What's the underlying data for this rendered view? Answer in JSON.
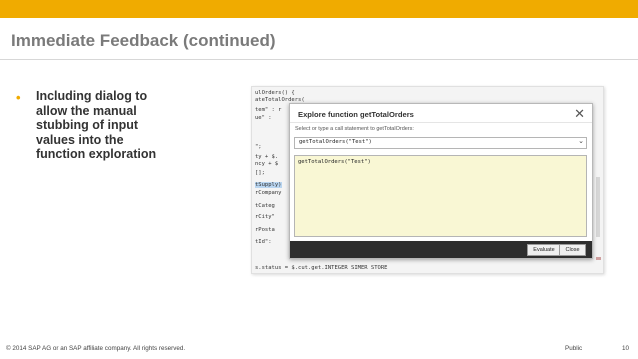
{
  "slide": {
    "title": "Immediate Feedback (continued)",
    "bullet": {
      "marker": "•",
      "lines": [
        "Including dialog to",
        "allow the manual",
        "stubbing of input",
        "values into the",
        "function exploration"
      ]
    }
  },
  "code_lines": [
    "ulOrders() {",
    "ateTotalOrders(",
    "tem\" : r",
    "ue\" :",
    "",
    "\";",
    "ty + $.",
    "ncy + $",
    "[];",
    "",
    "tSupply)",
    "rCompany",
    "",
    "tCateg",
    "",
    "rCity\"",
    "",
    "rPosta",
    "",
    "tId\":",
    "",
    "                 ",
    "s.status = $.cut.get.INTEGER  SIMER STORE"
  ],
  "dialog": {
    "title": "Explore function getTotalOrders",
    "close_glyph": "✕",
    "label": "Select or type a call statement to getTotalOrders:",
    "select_value": "getTotalOrders(\"Test\")",
    "chevron": "⌄",
    "editor_text": "getTotalOrders(\"Test\")",
    "evaluate_label": "Evaluate",
    "close_label": "Close"
  },
  "footer": {
    "copyright": "© 2014 SAP AG or an SAP affiliate company. All rights reserved.",
    "classification": "Public",
    "page": "10"
  },
  "colors": {
    "accent": "#f0ab00",
    "title": "#7a7a7a",
    "editor_bg": "#f9f7d4",
    "dialog_footer": "#2e2e2e"
  }
}
